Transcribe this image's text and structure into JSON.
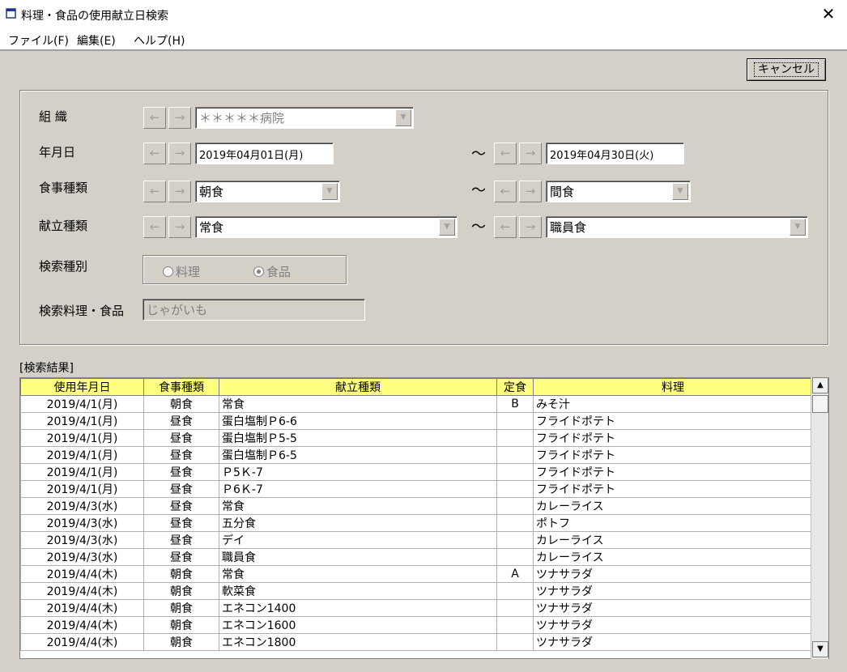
{
  "window": {
    "title": "料理・食品の使用献立日検索",
    "close": "✕"
  },
  "menu": [
    "ファイル(F)",
    "編集(E)",
    "ヘルプ(H)"
  ],
  "cancel_label": "キャンセル",
  "form": {
    "org_label": "組 織",
    "org_value": "＊＊＊＊＊病院",
    "date_label": "年月日",
    "date_from": "2019年04月01日(月)",
    "date_to": "2019年04月30日(火)",
    "meal_label": "食事種類",
    "meal_from": "朝食",
    "meal_to": "間食",
    "menu_label": "献立種類",
    "menu_from": "常食",
    "menu_to": "職員食",
    "search_type_label": "検索種別",
    "radio_dish": "料理",
    "radio_food": "食品",
    "search_item_label": "検索料理・食品",
    "search_item_value": "じゃがいも",
    "left_arrow": "←",
    "right_arrow": "→",
    "tilde": "～",
    "dropdown": "▼"
  },
  "results": {
    "label": "[検索結果]",
    "columns": [
      "使用年月日",
      "食事種類",
      "献立種類",
      "定食",
      "料理"
    ],
    "rows": [
      [
        "2019/4/1(月)",
        "朝食",
        "常食",
        "B",
        "みそ汁"
      ],
      [
        "2019/4/1(月)",
        "昼食",
        "蛋白塩制Ｐ6-6",
        "",
        "フライドポテト"
      ],
      [
        "2019/4/1(月)",
        "昼食",
        "蛋白塩制Ｐ5-5",
        "",
        "フライドポテト"
      ],
      [
        "2019/4/1(月)",
        "昼食",
        "蛋白塩制Ｐ6-5",
        "",
        "フライドポテト"
      ],
      [
        "2019/4/1(月)",
        "昼食",
        "Ｐ5Ｋ-7",
        "",
        "フライドポテト"
      ],
      [
        "2019/4/1(月)",
        "昼食",
        "Ｐ6Ｋ-7",
        "",
        "フライドポテト"
      ],
      [
        "2019/4/3(水)",
        "昼食",
        "常食",
        "",
        "カレーライス"
      ],
      [
        "2019/4/3(水)",
        "昼食",
        "五分食",
        "",
        "ポトフ"
      ],
      [
        "2019/4/3(水)",
        "昼食",
        "デイ",
        "",
        "カレーライス"
      ],
      [
        "2019/4/3(水)",
        "昼食",
        "職員食",
        "",
        "カレーライス"
      ],
      [
        "2019/4/4(木)",
        "朝食",
        "常食",
        "A",
        "ツナサラダ"
      ],
      [
        "2019/4/4(木)",
        "朝食",
        "軟菜食",
        "",
        "ツナサラダ"
      ],
      [
        "2019/4/4(木)",
        "朝食",
        "エネコン1400",
        "",
        "ツナサラダ"
      ],
      [
        "2019/4/4(木)",
        "朝食",
        "エネコン1600",
        "",
        "ツナサラダ"
      ],
      [
        "2019/4/4(木)",
        "朝食",
        "エネコン1800",
        "",
        "ツナサラダ"
      ]
    ]
  },
  "scroll": {
    "up": "▲",
    "down": "▼"
  }
}
